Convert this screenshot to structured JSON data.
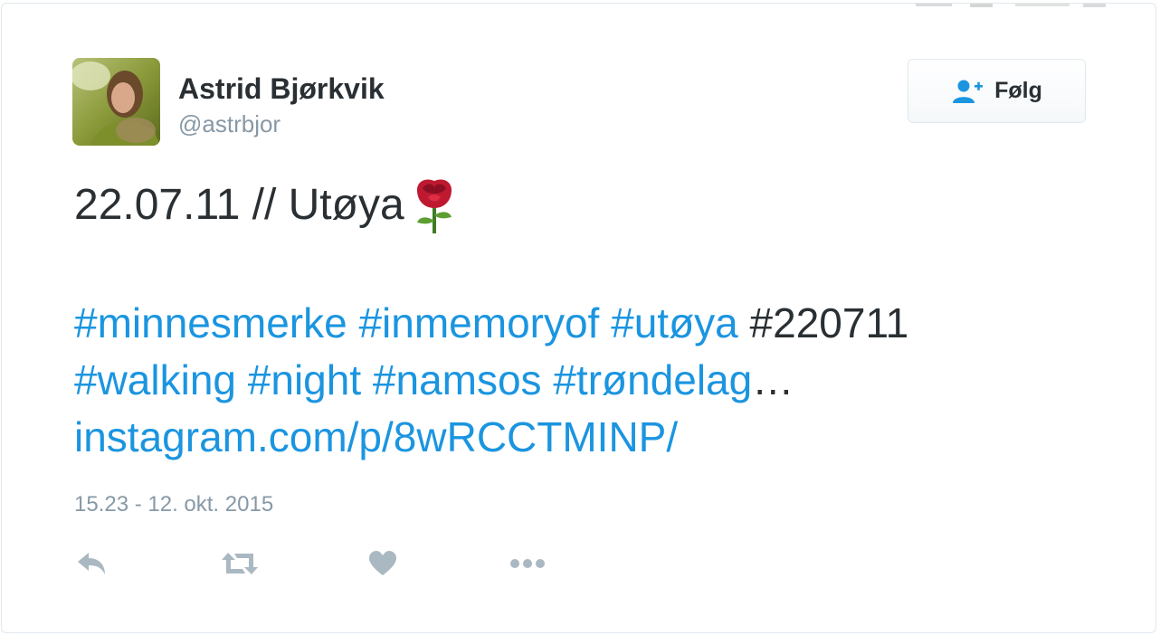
{
  "user": {
    "name": "Astrid Bjørkvik",
    "handle": "@astrbjor"
  },
  "follow_button": {
    "label": "Følg",
    "icon": "user-add-icon"
  },
  "tweet": {
    "first_line": "22.07.11 // Utøya",
    "emoji": "rose-icon",
    "line1": [
      {
        "text": "#minnesmerke",
        "type": "tag"
      },
      {
        "text": " ",
        "type": "plain"
      },
      {
        "text": "#inmemoryof",
        "type": "tag"
      },
      {
        "text": " ",
        "type": "plain"
      },
      {
        "text": "#utøya",
        "type": "tag"
      },
      {
        "text": " #220711",
        "type": "plain"
      }
    ],
    "line2": [
      {
        "text": "#walking",
        "type": "tag"
      },
      {
        "text": " ",
        "type": "plain"
      },
      {
        "text": "#night",
        "type": "tag"
      },
      {
        "text": " ",
        "type": "plain"
      },
      {
        "text": "#namsos",
        "type": "tag"
      },
      {
        "text": " ",
        "type": "plain"
      },
      {
        "text": "#trøndelag",
        "type": "tag"
      },
      {
        "text": "…",
        "type": "plain"
      }
    ],
    "link": "instagram.com/p/8wRCCTMINP/",
    "timestamp": "15.23 - 12. okt. 2015"
  },
  "actions": [
    {
      "name": "reply-icon"
    },
    {
      "name": "retweet-icon"
    },
    {
      "name": "heart-icon"
    },
    {
      "name": "more-icon"
    }
  ],
  "colors": {
    "link": "#1b95e0",
    "text": "#292f33",
    "muted": "#8899a6",
    "icon": "#aab8c2"
  }
}
